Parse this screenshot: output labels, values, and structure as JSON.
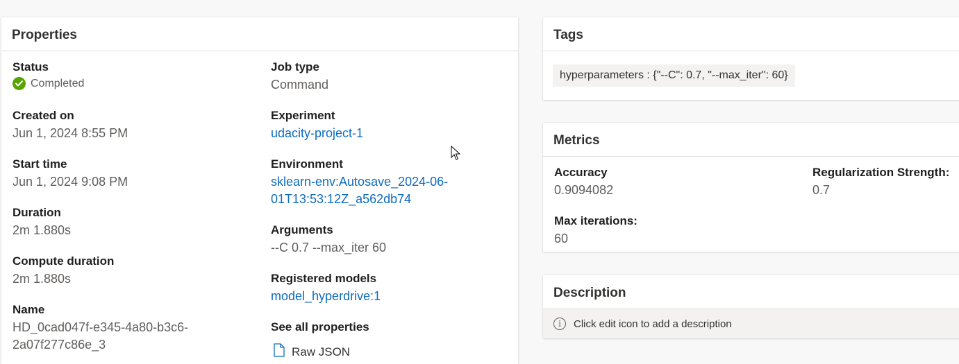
{
  "properties": {
    "title": "Properties",
    "status": {
      "label": "Status",
      "value": "Completed"
    },
    "created_on": {
      "label": "Created on",
      "value": "Jun 1, 2024 8:55 PM"
    },
    "start_time": {
      "label": "Start time",
      "value": "Jun 1, 2024 9:08 PM"
    },
    "duration": {
      "label": "Duration",
      "value": "2m 1.880s"
    },
    "compute_duration": {
      "label": "Compute duration",
      "value": "2m 1.880s"
    },
    "name": {
      "label": "Name",
      "value_line1": "HD_0cad047f-e345-4a80-b3c6-",
      "value_line2": "2a07f277c86e_3"
    },
    "job_type": {
      "label": "Job type",
      "value": "Command"
    },
    "experiment": {
      "label": "Experiment",
      "value": "udacity-project-1"
    },
    "environment": {
      "label": "Environment",
      "value_line1": "sklearn-env:Autosave_2024-06-",
      "value_line2": "01T13:53:12Z_a562db74"
    },
    "arguments": {
      "label": "Arguments",
      "value": "--C 0.7 --max_iter 60"
    },
    "registered_models": {
      "label": "Registered models",
      "value": "model_hyperdrive:1"
    },
    "see_all": {
      "label": "See all properties",
      "raw_json": "Raw JSON"
    }
  },
  "tags": {
    "title": "Tags",
    "items": [
      "hyperparameters : {\"--C\": 0.7, \"--max_iter\": 60}"
    ]
  },
  "metrics": {
    "title": "Metrics",
    "accuracy": {
      "label": "Accuracy",
      "value": "0.9094082"
    },
    "regularization": {
      "label": "Regularization Strength:",
      "value": "0.7"
    },
    "max_iterations": {
      "label": "Max iterations:",
      "value": "60"
    }
  },
  "description": {
    "title": "Description",
    "placeholder": "Click edit icon to add a description"
  },
  "colors": {
    "link": "#0f6cbd",
    "success": "#57a300"
  },
  "icons": {
    "status": "check-circle-icon",
    "info": "info-icon",
    "file": "file-code-icon",
    "cursor": "mouse-pointer-icon"
  }
}
